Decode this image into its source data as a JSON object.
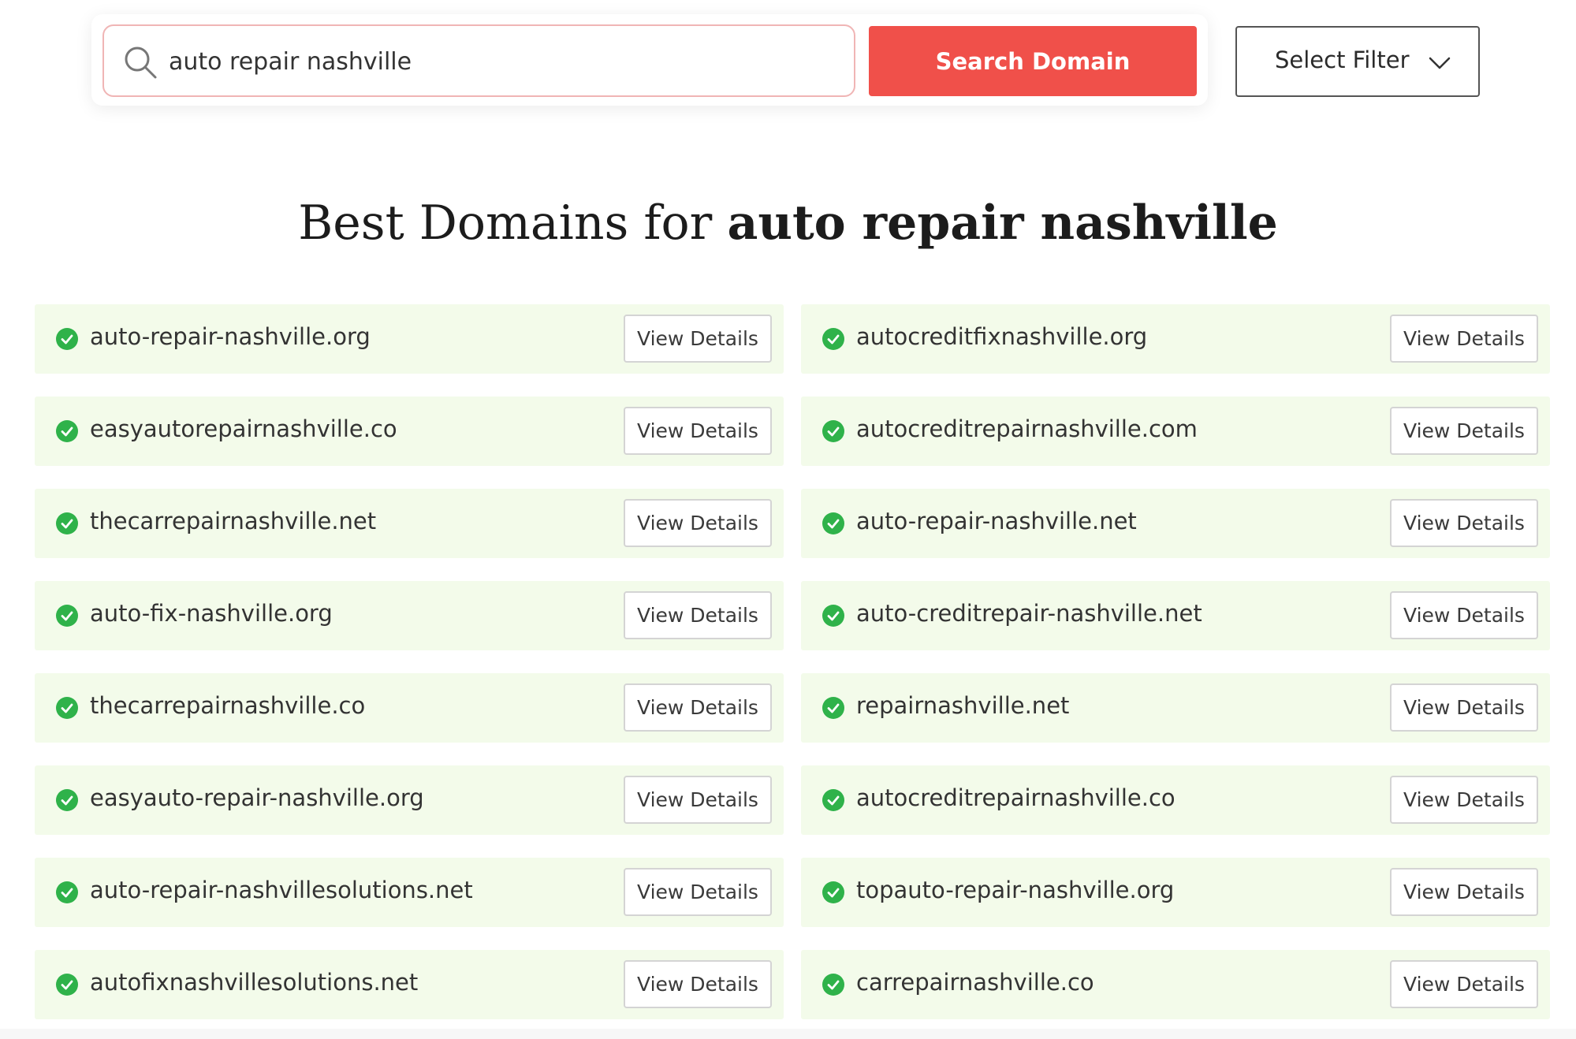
{
  "search": {
    "value": "auto repair nashville",
    "button_label": "Search Domain"
  },
  "filter": {
    "label": "Select Filter"
  },
  "heading": {
    "prefix": "Best Domains for ",
    "query": "auto repair nashville"
  },
  "colors": {
    "accent": "#f0504a",
    "row_background": "#f3fbea",
    "check": "#2fb24a"
  },
  "view_details_label": "View Details",
  "results": [
    "auto-repair-nashville.org",
    "autocreditfixnashville.org",
    "easyautorepairnashville.co",
    "autocreditrepairnashville.com",
    "thecarrepairnashville.net",
    "auto-repair-nashville.net",
    "auto-fix-nashville.org",
    "auto-creditrepair-nashville.net",
    "thecarrepairnashville.co",
    "repairnashville.net",
    "easyauto-repair-nashville.org",
    "autocreditrepairnashville.co",
    "auto-repair-nashvillesolutions.net",
    "topauto-repair-nashville.org",
    "autofixnashvillesolutions.net",
    "carrepairnashville.co"
  ]
}
